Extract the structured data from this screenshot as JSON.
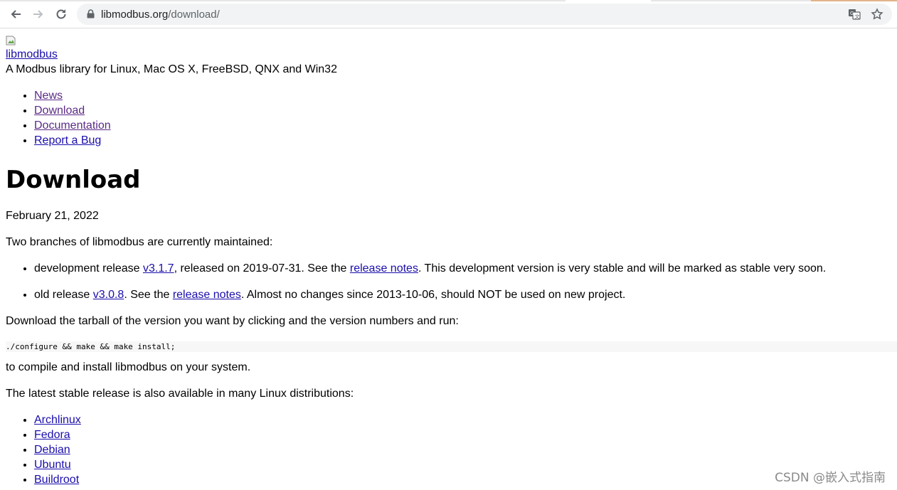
{
  "browser": {
    "url_host": "libmodbus.org",
    "url_path": "/download/",
    "back_icon": "arrow-left-icon",
    "forward_icon": "arrow-right-icon",
    "reload_icon": "reload-icon",
    "lock_icon": "lock-icon",
    "translate_icon": "translate-icon",
    "bookmark_icon": "star-icon"
  },
  "site": {
    "brand": "libmodbus",
    "tagline": "A Modbus library for Linux, Mac OS X, FreeBSD, QNX and Win32",
    "nav": [
      "News",
      "Download",
      "Documentation",
      "Report a Bug"
    ]
  },
  "content": {
    "heading": "Download",
    "date": "February 21, 2022",
    "intro": "Two branches of libmodbus are currently maintained:",
    "releases": [
      {
        "prefix": "development release ",
        "version": "v3.1.7",
        "middle": ", released on 2019-07-31. See the ",
        "notes": "release notes",
        "suffix": ". This development version is very stable and will be marked as stable very soon."
      },
      {
        "prefix": "old release ",
        "version": "v3.0.8",
        "middle": ". See the ",
        "notes": "release notes",
        "suffix": ". Almost no changes since 2013-10-06, should NOT be used on new project."
      }
    ],
    "download_instr": "Download the tarball of the version you want by clicking and the version numbers and run:",
    "code": "./configure && make && make install;",
    "compile_text": "to compile and install libmodbus on your system.",
    "distros_intro": "The latest stable release is also available in many Linux distributions:",
    "distros": [
      "Archlinux",
      "Fedora",
      "Debian",
      "Ubuntu",
      "Buildroot"
    ]
  },
  "watermark": "CSDN @嵌入式指南",
  "colors": {
    "link": "#1a0dab",
    "visited_link": "#5a2a87"
  }
}
